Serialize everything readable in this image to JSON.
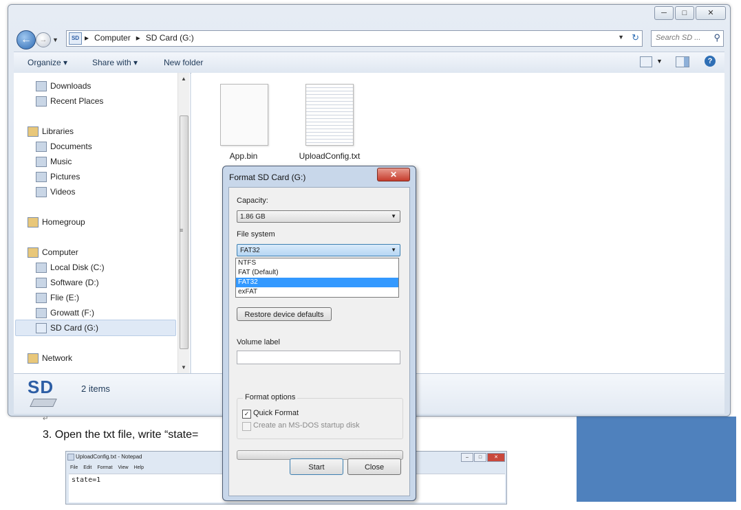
{
  "document": {
    "step_text": "3.  Open the txt file, write “state=",
    "return_mark": "↵"
  },
  "notepad": {
    "title": "UploadConfig.txt - Notepad",
    "menu": [
      "File",
      "Edit",
      "Format",
      "View",
      "Help"
    ],
    "content": "state=1"
  },
  "explorer": {
    "breadcrumbs": [
      "Computer",
      "SD Card (G:)"
    ],
    "search_placeholder": "Search SD ...",
    "toolbar": {
      "organize": "Organize ▾",
      "share_with": "Share with ▾",
      "new_folder": "New folder"
    },
    "nav_items": [
      {
        "label": "Downloads",
        "icon": "downloads-icon",
        "indent": 1
      },
      {
        "label": "Recent Places",
        "icon": "recent-places-icon",
        "indent": 1
      },
      {
        "label": "Libraries",
        "icon": "libraries-icon",
        "indent": 0
      },
      {
        "label": "Documents",
        "icon": "documents-icon",
        "indent": 1
      },
      {
        "label": "Music",
        "icon": "music-icon",
        "indent": 1
      },
      {
        "label": "Pictures",
        "icon": "pictures-icon",
        "indent": 1
      },
      {
        "label": "Videos",
        "icon": "videos-icon",
        "indent": 1
      },
      {
        "label": "Homegroup",
        "icon": "homegroup-icon",
        "indent": 0
      },
      {
        "label": "Computer",
        "icon": "computer-icon",
        "indent": 0
      },
      {
        "label": "Local Disk (C:)",
        "icon": "local-disk-icon",
        "indent": 1
      },
      {
        "label": "Software (D:)",
        "icon": "drive-icon",
        "indent": 1
      },
      {
        "label": "Flie (E:)",
        "icon": "drive-icon",
        "indent": 1
      },
      {
        "label": "Growatt (F:)",
        "icon": "drive-icon",
        "indent": 1
      },
      {
        "label": "SD Card (G:)",
        "icon": "sd-card-icon",
        "indent": 1,
        "selected": true
      },
      {
        "label": "Network",
        "icon": "network-icon",
        "indent": 0
      }
    ],
    "files": [
      {
        "name": "App.bin",
        "icon": "bin-file-icon"
      },
      {
        "name": "UploadConfig.txt",
        "icon": "text-file-icon"
      }
    ],
    "details": {
      "logo_text": "SD",
      "items_count": "2 items"
    }
  },
  "dialog": {
    "title": "Format SD Card (G:)",
    "close_glyph": "✕",
    "capacity_label": "Capacity:",
    "capacity_value": "1.86 GB",
    "fs_label": "File system",
    "fs_value": "FAT32",
    "fs_options": [
      "NTFS",
      "FAT (Default)",
      "FAT32",
      "exFAT"
    ],
    "fs_selected_index": 2,
    "restore_button": "Restore device defaults",
    "volume_label": "Volume label",
    "volume_value": "",
    "format_options_label": "Format options",
    "quick_format_label": "Quick Format",
    "quick_format_checked": true,
    "msdos_label": "Create an MS-DOS startup disk",
    "msdos_checked": false,
    "progress": 0,
    "start_button": "Start",
    "close_button": "Close"
  },
  "colors": {
    "accent_blue": "#2d5ea5",
    "selection_blue": "#3399ff",
    "doc_panel_blue": "#4f81bd",
    "dialog_close_red": "#c53c2c"
  }
}
